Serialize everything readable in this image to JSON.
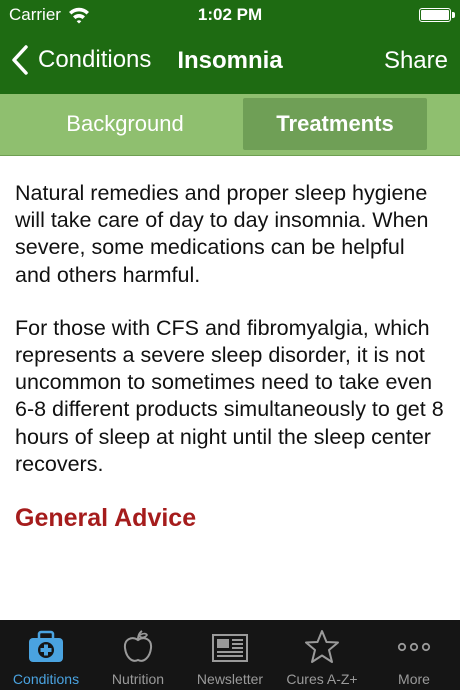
{
  "status": {
    "carrier": "Carrier",
    "time": "1:02 PM"
  },
  "nav": {
    "back_label": "Conditions",
    "title": "Insomnia",
    "share_label": "Share"
  },
  "segments": [
    {
      "label": "Background",
      "selected": false
    },
    {
      "label": "Treatments",
      "selected": true
    }
  ],
  "content": {
    "paragraphs": [
      "Natural remedies and proper sleep hygiene will take care of day to day insomnia. When severe, some medications can be helpful and others harmful.",
      "For those with CFS and fibromyalgia, which represents a severe sleep disorder, it is not uncommon to sometimes need to take even 6-8 different products simultaneously to get 8 hours of sleep at night until the sleep center recovers."
    ],
    "heading": "General Advice"
  },
  "tabbar": {
    "items": [
      {
        "label": "Conditions",
        "icon": "medical-kit-icon",
        "active": true
      },
      {
        "label": "Nutrition",
        "icon": "apple-icon",
        "active": false
      },
      {
        "label": "Newsletter",
        "icon": "newspaper-icon",
        "active": false
      },
      {
        "label": "Cures A-Z+",
        "icon": "star-icon",
        "active": false
      },
      {
        "label": "More",
        "icon": "more-dots-icon",
        "active": false
      }
    ]
  },
  "colors": {
    "nav_green": "#1e6b12",
    "segment_green": "#8fbf6f",
    "heading_red": "#a51c1c",
    "tab_active_blue": "#4aa3e0"
  }
}
